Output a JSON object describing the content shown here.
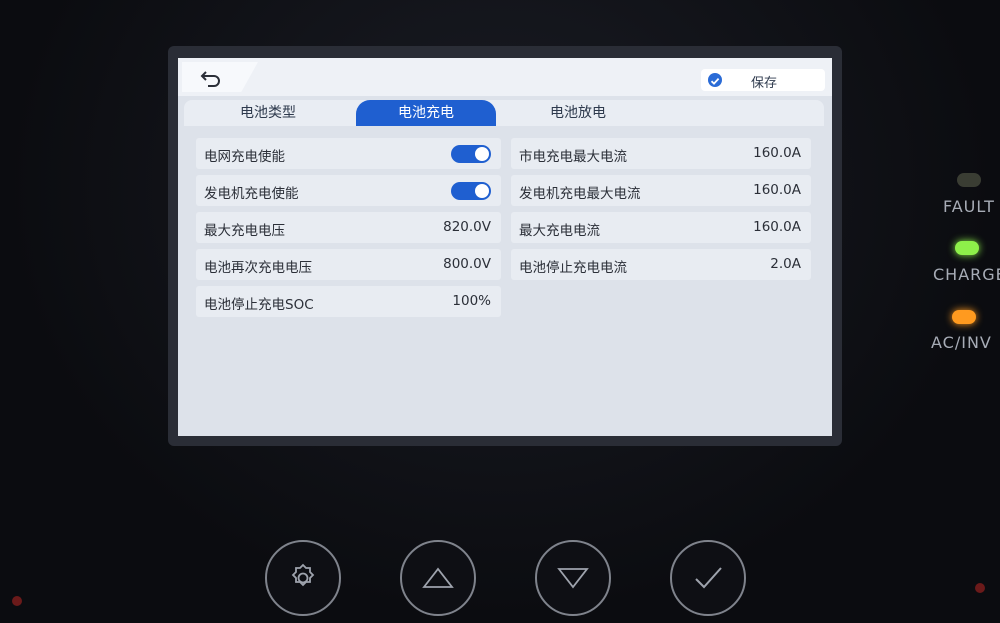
{
  "header": {
    "back_icon": "back-arrow-icon",
    "save_label": "保存",
    "save_icon": "checkmark-circle-icon"
  },
  "tabs": [
    {
      "label": "电池类型",
      "active": false
    },
    {
      "label": "电池充电",
      "active": true
    },
    {
      "label": "电池放电",
      "active": false
    }
  ],
  "left_rows": [
    {
      "label": "电网充电使能",
      "toggle": true
    },
    {
      "label": "发电机充电使能",
      "toggle": true
    },
    {
      "label": "最大充电电压",
      "value": "820.0V"
    },
    {
      "label": "电池再次充电电压",
      "value": "800.0V"
    },
    {
      "label": "电池停止充电SOC",
      "value": "100%"
    }
  ],
  "right_rows": [
    {
      "label": "市电充电最大电流",
      "value": "160.0A"
    },
    {
      "label": "发电机充电最大电流",
      "value": "160.0A"
    },
    {
      "label": "最大充电电流",
      "value": "160.0A"
    },
    {
      "label": "电池停止充电电流",
      "value": "2.0A"
    }
  ],
  "indicators": [
    {
      "label": "FAULT",
      "color": "#3a3d33"
    },
    {
      "label": "CHARGE",
      "color": "#8ef04a"
    },
    {
      "label": "AC/INV",
      "color": "#ff9a1f"
    }
  ],
  "hardware_buttons": [
    {
      "icon": "gear-icon"
    },
    {
      "icon": "up-arrow-icon"
    },
    {
      "icon": "down-arrow-icon"
    },
    {
      "icon": "check-icon"
    }
  ],
  "colors": {
    "accent": "#1f5fd0",
    "screen_bg": "#dde2ea"
  }
}
